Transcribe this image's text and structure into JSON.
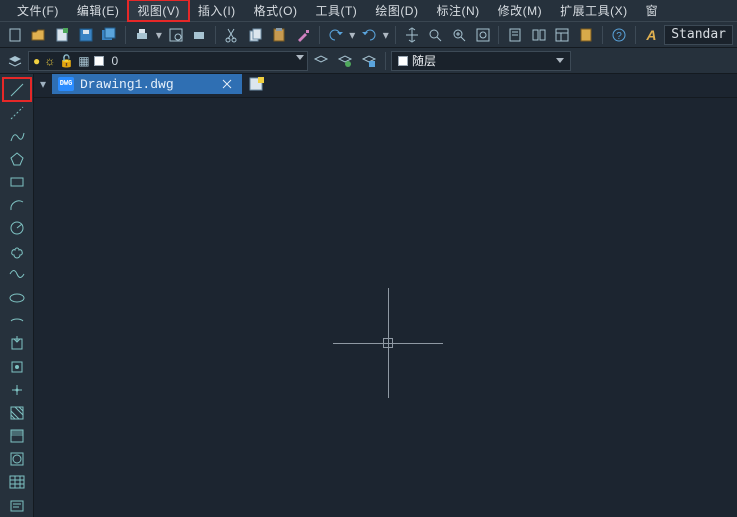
{
  "menus": {
    "file": "文件(F)",
    "edit": "编辑(E)",
    "view": "视图(V)",
    "insert": "插入(I)",
    "format": "格式(O)",
    "tools": "工具(T)",
    "draw": "绘图(D)",
    "annotate": "标注(N)",
    "modify": "修改(M)",
    "ext": "扩展工具(X)",
    "window": "窗"
  },
  "toolbar1": {
    "style_label": "Standar"
  },
  "toolbar2": {
    "layer_name": "0",
    "color_layer": "随层"
  },
  "tab": {
    "filename": "Drawing1.dwg"
  },
  "icons": {
    "lightbulb": "●",
    "sun": "☀",
    "lock": "■"
  }
}
